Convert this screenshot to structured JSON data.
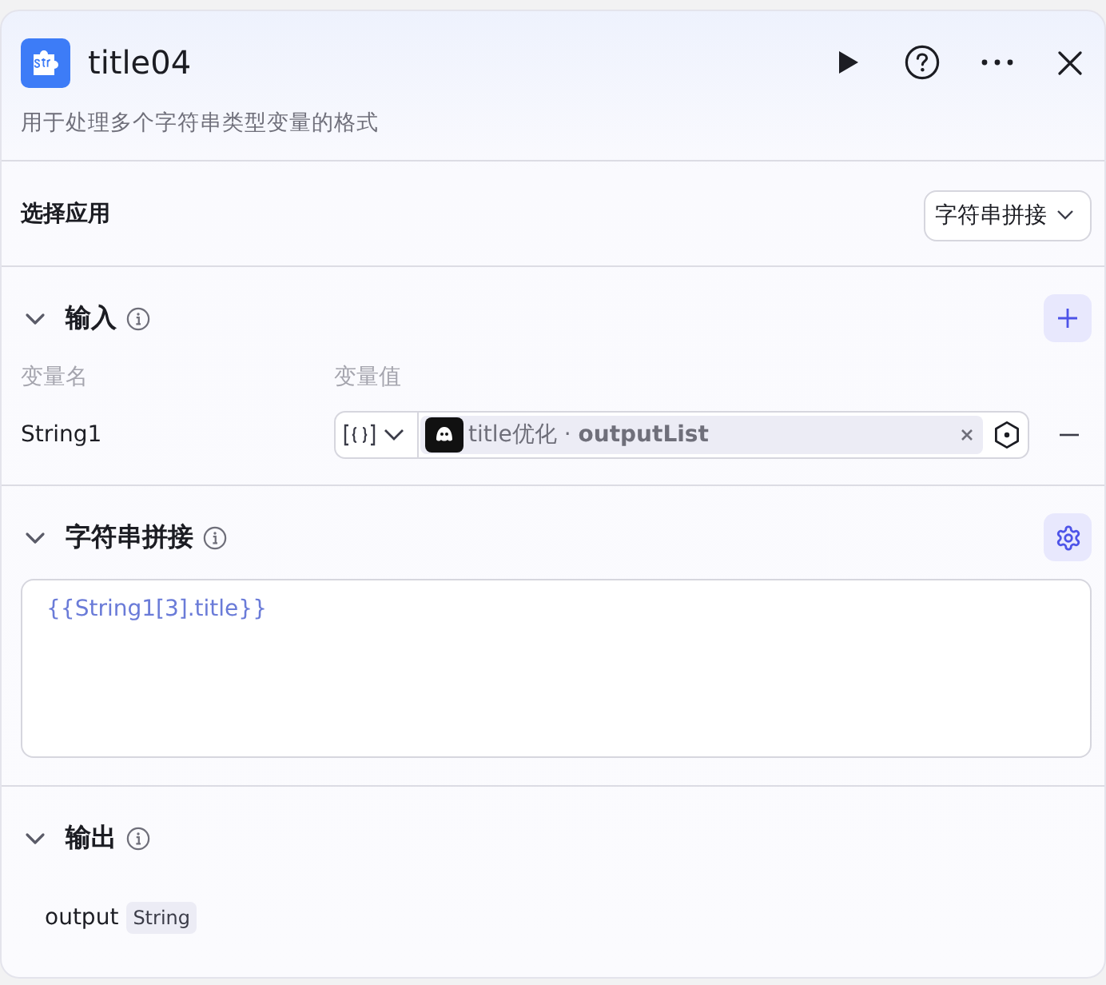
{
  "header": {
    "title": "title04",
    "description": "用于处理多个字符串类型变量的格式"
  },
  "app_select": {
    "label": "选择应用",
    "value": "字符串拼接"
  },
  "sections": [
    {
      "kind": "inputs",
      "title": "输入",
      "expanded": true,
      "columns": [
        "变量名",
        "变量值"
      ],
      "rows": [
        {
          "name": "String1",
          "reference": "title优化 · **outputList**"
        }
      ]
    },
    {
      "kind": "template",
      "title": "字符串拼接",
      "expanded": true,
      "text": "{{String1[3].title}}"
    },
    {
      "kind": "outputs",
      "title": "输出",
      "expanded": true,
      "rows": [
        {
          "name": "output",
          "type": "String"
        }
      ]
    }
  ]
}
